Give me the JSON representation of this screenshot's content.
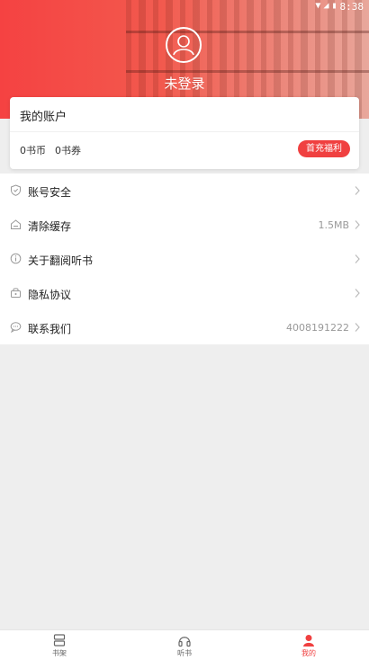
{
  "status_bar": {
    "time": "8:38"
  },
  "profile": {
    "login_text": "未登录"
  },
  "account": {
    "title": "我的账户",
    "coins": "0书币",
    "vouchers": "0书券",
    "recharge_button": "首充福利"
  },
  "menu": {
    "items": [
      {
        "icon": "shield-icon",
        "label": "账号安全",
        "value": ""
      },
      {
        "icon": "cache-icon",
        "label": "清除缓存",
        "value": "1.5MB"
      },
      {
        "icon": "info-icon",
        "label": "关于翻阅听书",
        "value": ""
      },
      {
        "icon": "privacy-icon",
        "label": "隐私协议",
        "value": ""
      },
      {
        "icon": "chat-icon",
        "label": "联系我们",
        "value": "4008191222"
      }
    ]
  },
  "tabbar": {
    "tabs": [
      {
        "icon": "bookshelf-icon",
        "label": "书架",
        "active": false
      },
      {
        "icon": "headphones-icon",
        "label": "听书",
        "active": false
      },
      {
        "icon": "user-icon",
        "label": "我的",
        "active": true
      }
    ]
  },
  "colors": {
    "accent": "#f04040",
    "header_start": "#f54242",
    "background": "#eeeeee"
  }
}
